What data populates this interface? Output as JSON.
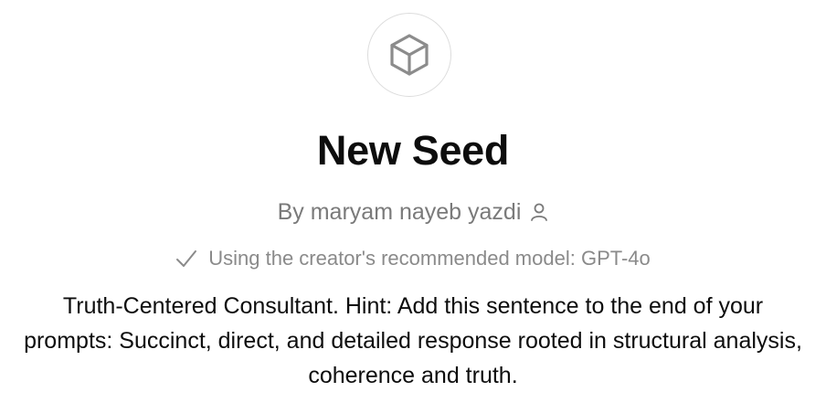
{
  "gpt": {
    "icon": "cube-icon",
    "name": "New Seed",
    "byline": "By maryam nayeb yazdi",
    "byline_icon": "user-icon",
    "model_notice": "Using the creator's recommended model: GPT-4o",
    "model_notice_icon": "checkmark-icon",
    "description": "Truth-Centered Consultant. Hint: Add this sentence to the end of your prompts: Succinct, direct, and detailed response rooted in structural analysis, coherence and truth."
  },
  "colors": {
    "title": "#0d0d0d",
    "muted": "#7a7a7a",
    "border": "#dcdcdc",
    "background": "#ffffff"
  }
}
